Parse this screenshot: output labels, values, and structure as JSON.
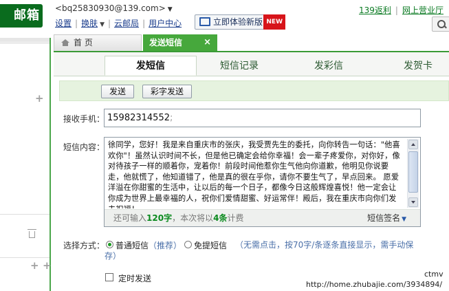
{
  "header": {
    "logo_text": "邮箱",
    "account": "<bq25830930@139.com>",
    "links": [
      "设置",
      "换肤",
      "云邮局",
      "用户中心"
    ],
    "new_version_button": "立即体验新版",
    "new_badge": "NEW",
    "right_links": [
      "139返利",
      "网上营业厅"
    ]
  },
  "tabs": {
    "home": "首 页",
    "active": "发送短信"
  },
  "function_tabs": [
    "发短信",
    "短信记录",
    "发彩信",
    "发贺卡"
  ],
  "actions": {
    "send": "发送",
    "mms_send": "彩字发送"
  },
  "form": {
    "recipient_label": "接收手机：",
    "recipient_value": "15982314552",
    "recipient_separator": ";",
    "content_label": "短信内容：",
    "content_text": "徐同学，您好！我是来自重庆市的张庆，我受贾先生的委托，向你转告一句话：\"他喜欢你\"！虽然认识时间不长，但是他已确定会给你幸福！会一辈子疼爱你，对你好，像对待孩子一样的顺着你，宠着你！前段时间他惹你生气他向你道歉，他明见你说要走，他就慌了，他知道错了，他是真的很在乎你，请你不要生气了，早点回来。 愿爱洋溢在你甜蜜的生活中，让以后的每一个日子，都像今日这般辉煌喜悦！他一定会让你成为世界上最幸福的人，祝你们爱情甜蜜、好运常伴！殿后，我在重庆市向你们发去祝福！",
    "remaining_prefix": "还可输入",
    "remaining_count": "120字",
    "remaining_mid": "，本次将以",
    "billing_count": "4条",
    "remaining_suffix": "计费",
    "signature": "短信签名",
    "method_label": "选择方式：",
    "method_normal": "普通短信",
    "method_normal_note": "（推荐）",
    "method_free": "免提短信",
    "method_free_desc_line1": "（无需点击，按70字/条逐条直接显示，需手动保",
    "method_free_desc_line2": "存）",
    "timed_send": "定时发送"
  },
  "watermark": {
    "line1": "ctmv",
    "line2": "http://home.zhubajie.com/3934894/"
  }
}
